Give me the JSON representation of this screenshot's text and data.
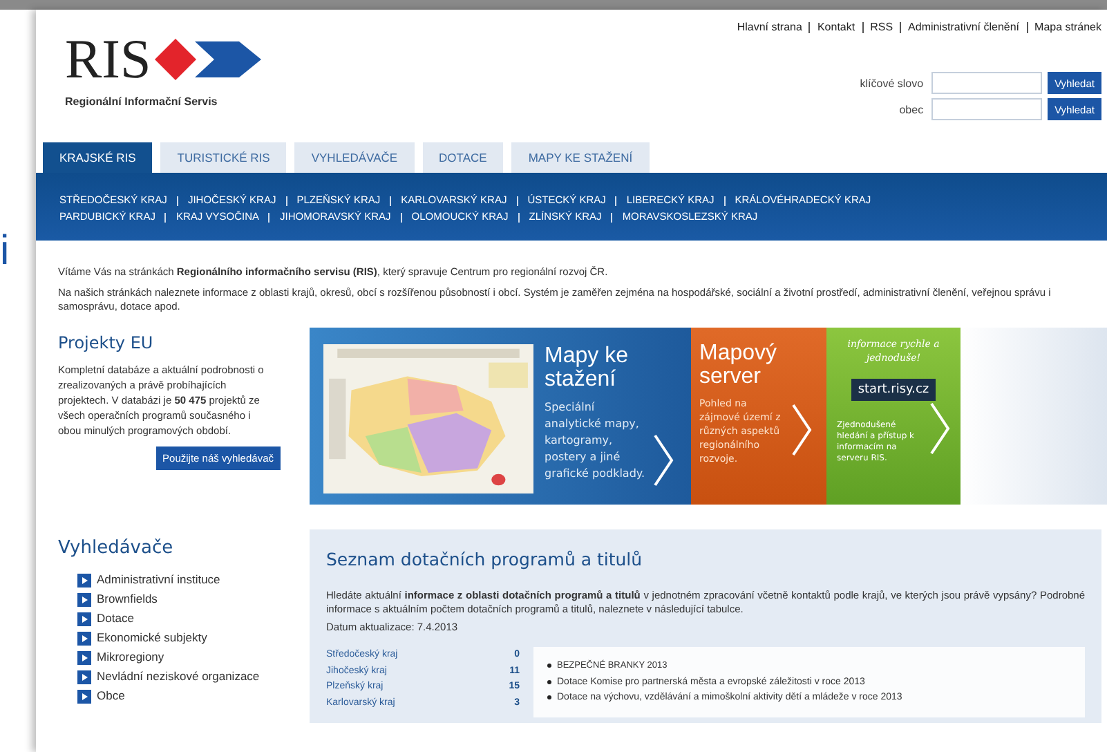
{
  "edge_fragment": "i",
  "top_links": [
    "Hlavní strana",
    "Kontakt",
    "RSS",
    "Administrativní členění",
    "Mapa stránek"
  ],
  "logo": {
    "text": "RIS",
    "subtitle": "Regionální Informační Servis"
  },
  "search": [
    {
      "label": "klíčové slovo",
      "button": "Vyhledat"
    },
    {
      "label": "obec",
      "button": "Vyhledat"
    }
  ],
  "tabs": [
    {
      "label": "KRAJSKÉ RIS",
      "selected": true
    },
    {
      "label": "TURISTICKÉ RIS",
      "selected": false
    },
    {
      "label": "VYHLEDÁVAČE",
      "selected": false
    },
    {
      "label": "DOTACE",
      "selected": false
    },
    {
      "label": "MAPY KE STAŽENÍ",
      "selected": false
    }
  ],
  "regions": [
    [
      "STŘEDOČESKÝ KRAJ",
      "JIHOČESKÝ KRAJ",
      "PLZEŇSKÝ KRAJ",
      "KARLOVARSKÝ KRAJ",
      "ÚSTECKÝ KRAJ",
      "LIBERECKÝ KRAJ",
      "KRÁLOVÉHRADECKÝ KRAJ"
    ],
    [
      "PARDUBICKÝ KRAJ",
      "KRAJ VYSOČINA",
      "JIHOMORAVSKÝ KRAJ",
      "OLOMOUCKÝ KRAJ",
      "ZLÍNSKÝ KRAJ",
      "MORAVSKOSLEZSKÝ KRAJ"
    ]
  ],
  "intro": [
    "Vítáme Vás na stránkách **Regionálního informačního servisu (RIS)**, který spravuje Centrum pro regionální rozvoj ČR.",
    "Na našich stránkách naleznete informace z oblasti krajů, okresů, obcí s rozšířenou působností i obcí. Systém je zaměřen zejména na hospodářské, sociální a životní prostředí, administrativní členění, veřejnou správu i samosprávu, dotace apod."
  ],
  "projects": {
    "title": "Projekty EU",
    "text": "Kompletní databáze a aktuální podrobnosti o zrealizovaných a právě probíhajících projektech. V databázi je **50 475** projektů ze všech operačních programů současného i obou minulých programových období.",
    "button": "Použijte náš vyhledávač"
  },
  "banners": [
    {
      "kind": "maps",
      "title": "Mapy ke stažení",
      "text": "Speciální analytické mapy, kartogramy, postery a jiné grafické podklady."
    },
    {
      "kind": "server",
      "title": "Mapový server",
      "text": "Pohled na zájmové území z různých aspektů regionálního rozvoje."
    },
    {
      "kind": "start",
      "slogan": "informace rychle a jednoduše!",
      "title": "start.risy.cz",
      "text": "Zjednodušené hledání a přístup k informacím na serveru RIS."
    }
  ],
  "finders": {
    "title": "Vyhledávače",
    "items": [
      "Administrativní instituce",
      "Brownfields",
      "Dotace",
      "Ekonomické subjekty",
      "Mikroregiony",
      "Nevládní neziskové organizace",
      "Obce"
    ]
  },
  "grants": {
    "title": "Seznam dotačních programů a titulů",
    "text": "Hledáte aktuální **informace z oblasti dotačních programů a titulů** v jednotném zpracování včetně kontaktů podle krajů, ve kterých jsou právě vypsány? Podrobné informace s aktuálním počtem dotačních programů a titulů, naleznete v následující tabulce.",
    "date": "Datum aktualizace: 7.4.2013",
    "regions": [
      {
        "name": "Středočeský kraj",
        "count": "0"
      },
      {
        "name": "Jihočeský kraj",
        "count": "11"
      },
      {
        "name": "Plzeňský kraj",
        "count": "15"
      },
      {
        "name": "Karlovarský kraj",
        "count": "3"
      }
    ],
    "programs": [
      "BEZPEČNÉ BRANKY 2013",
      "Dotace Komise pro partnerská města a evropské záležitosti v roce 2013",
      "Dotace na výchovu, vzdělávání a mimoškolní aktivity dětí a mládeže v roce 2013"
    ]
  }
}
